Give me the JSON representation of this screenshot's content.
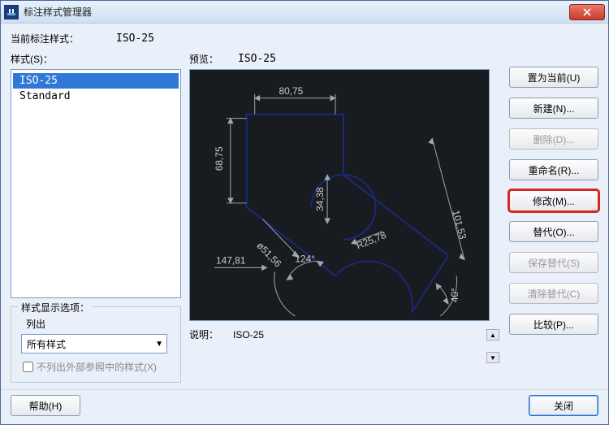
{
  "window": {
    "title": "标注样式管理器"
  },
  "header": {
    "current_label": "当前标注样式：",
    "current_value": "ISO-25"
  },
  "styles": {
    "label": "样式(S)：",
    "items": [
      {
        "name": "ISO-25",
        "selected": true
      },
      {
        "name": "Standard",
        "selected": false
      }
    ]
  },
  "display_options": {
    "legend": "样式显示选项：",
    "sub_label": "列出",
    "dropdown_value": "所有样式",
    "checkbox_label": "不列出外部参照中的样式(X)",
    "checkbox_checked": false
  },
  "preview": {
    "label": "预览：",
    "value": "ISO-25",
    "dims": {
      "d1": "80,75",
      "d2": "68,75",
      "d3": "34,38",
      "d4": "101,53",
      "d5": "ø51,56",
      "d6": "R25,78",
      "d7": "147,81",
      "d8": "124°",
      "d9": "40°"
    }
  },
  "description": {
    "label": "说明：",
    "text": "ISO-25"
  },
  "buttons": {
    "set_current": "置为当前(U)",
    "new": "新建(N)...",
    "delete": "删除(D)...",
    "rename": "重命名(R)...",
    "modify": "修改(M)...",
    "override": "替代(O)...",
    "save_override": "保存替代(S)",
    "clear_override": "清除替代(C)",
    "compare": "比较(P)..."
  },
  "footer": {
    "help": "帮助(H)",
    "close": "关闭"
  }
}
